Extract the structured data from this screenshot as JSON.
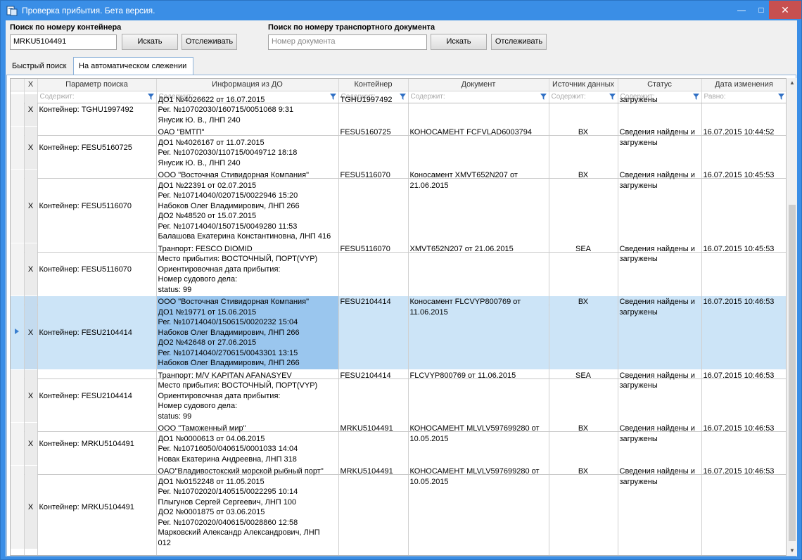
{
  "window": {
    "title": "Проверка прибытия. Бета версия."
  },
  "search_container": {
    "label": "Поиск по номеру контейнера",
    "value": "MRKU5104491",
    "search_btn": "Искать",
    "track_btn": "Отслеживать"
  },
  "search_doc": {
    "label": "Поиск по номеру транспортного документа",
    "placeholder": "Номер документа",
    "search_btn": "Искать",
    "track_btn": "Отслеживать"
  },
  "tabs": [
    {
      "label": "Быстрый поиск"
    },
    {
      "label": "На автоматическом слежении"
    }
  ],
  "grid": {
    "headers": {
      "x": "X",
      "param": "Параметр поиска",
      "info": "Информация из ДО",
      "container": "Контейнер",
      "document": "Документ",
      "source": "Источник данных",
      "status": "Статус",
      "date": "Дата изменения"
    },
    "filters": {
      "contains": "Содержит:",
      "equals": "Равно:"
    },
    "rows": [
      {
        "x": "X",
        "param": "Контейнер: TGHU1997492",
        "info": [
          "ДО1 №4026622 от 16.07.2015",
          "Рег. №10702030/160715/0051068 9:31",
          "Янусик Ю. В., ЛНП 240"
        ],
        "container": "TGHU1997492",
        "document": "",
        "source": "",
        "status": "загружены",
        "date": ""
      },
      {
        "x": "X",
        "param": "Контейнер: FESU5160725",
        "info": [
          "ОАО \"ВМТП\"",
          "ДО1 №4026167 от 11.07.2015",
          "Рег. №10702030/110715/0049712 18:18",
          "Янусик Ю. В., ЛНП 240"
        ],
        "container": "FESU5160725",
        "document": "КОНОСАМЕНТ FCFVLAD6003794",
        "source": "ВХ",
        "status": "Сведения найдены и загружены",
        "date": "16.07.2015 10:44:52"
      },
      {
        "x": "X",
        "param": "Контейнер: FESU5116070",
        "info": [
          "ООО \"Восточная Стивидорная Компания\"",
          "ДО1 №22391 от 02.07.2015",
          "Рег. №10714040/020715/0022946 15:20",
          "Набоков Олег Владимирович, ЛНП 266",
          "ДО2 №48520 от 15.07.2015",
          "Рег. №10714040/150715/0049280 11:53",
          "Балашова Екатерина Константиновна, ЛНП 416"
        ],
        "container": "FESU5116070",
        "document": "Коносамент XMVT652N207 от 21.06.2015",
        "source": "ВХ",
        "status": "Сведения найдены и загружены",
        "date": "16.07.2015 10:45:53"
      },
      {
        "x": "X",
        "param": "Контейнер: FESU5116070",
        "info": [
          "Транпорт: FESCO DIOMID",
          "Место прибытия: ВОСТОЧНЫЙ, ПОРТ(VYP)",
          "Ориентировочная дата прибытия:",
          "Номер судового дела:",
          "status: 99"
        ],
        "container": "FESU5116070",
        "document": "XMVT652N207 от 21.06.2015",
        "source": "SEA",
        "status": "Сведения найдены и загружены",
        "date": "16.07.2015 10:45:53"
      },
      {
        "x": "X",
        "param": "Контейнер: FESU2104414",
        "selected": true,
        "info": [
          "ООО \"Восточная Стивидорная Компания\"",
          "ДО1 №19771 от 15.06.2015",
          "Рег. №10714040/150615/0020232 15:04",
          "Набоков Олег Владимирович, ЛНП 266",
          "ДО2 №42648 от 27.06.2015",
          "Рег. №10714040/270615/0043301 13:15",
          "Набоков Олег Владимирович, ЛНП 266"
        ],
        "container": "FESU2104414",
        "document": "Коносамент FLCVYP800769 от 11.06.2015",
        "source": "ВХ",
        "status": "Сведения найдены и загружены",
        "date": "16.07.2015 10:46:53"
      },
      {
        "x": "X",
        "param": "Контейнер: FESU2104414",
        "info": [
          "Транпорт: M/V KAPITAN AFANASYEV",
          "Место прибытия: ВОСТОЧНЫЙ, ПОРТ(VYP)",
          "Ориентировочная дата прибытия:",
          "Номер судового дела:",
          "status: 99"
        ],
        "container": "FESU2104414",
        "document": "FLCVYP800769 от 11.06.2015",
        "source": "SEA",
        "status": "Сведения найдены и загружены",
        "date": "16.07.2015 10:46:53"
      },
      {
        "x": "X",
        "param": "Контейнер: MRKU5104491",
        "info": [
          "ООО \"Таможенный мир\"",
          "ДО1 №0000613 от 04.06.2015",
          "Рег. №10716050/040615/0001033 14:04",
          "Новак Екатерина Андреевна, ЛНП 318"
        ],
        "container": "MRKU5104491",
        "document": "КОНОСАМЕНТ MLVLV597699280 от 10.05.2015",
        "source": "ВХ",
        "status": "Сведения найдены и загружены",
        "date": "16.07.2015 10:46:53"
      },
      {
        "x": "X",
        "param": "Контейнер: MRKU5104491",
        "info": [
          "ОАО\"Владивостокский морской рыбный порт\"",
          "ДО1 №0152248 от 11.05.2015",
          "Рег. №10702020/140515/0022295 10:14",
          "Плыгунов Сергей Сергеевич, ЛНП 100",
          "ДО2 №0001875 от 03.06.2015",
          "Рег. №10702020/040615/0028860 12:58",
          "Марковский Александр Александрович, ЛНП",
          "012"
        ],
        "container": "MRKU5104491",
        "document": "КОНОСАМЕНТ MLVLV597699280 от 10.05.2015",
        "source": "ВХ",
        "status": "Сведения найдены и загружены",
        "date": "16.07.2015 10:46:53"
      }
    ]
  },
  "icons": {
    "app": "app-icon",
    "filter": "filter-icon",
    "row_pointer": "row-pointer-icon"
  },
  "colors": {
    "titlebar": "#3a8ee6",
    "selection": "#cce4f7",
    "close": "#c75050"
  }
}
